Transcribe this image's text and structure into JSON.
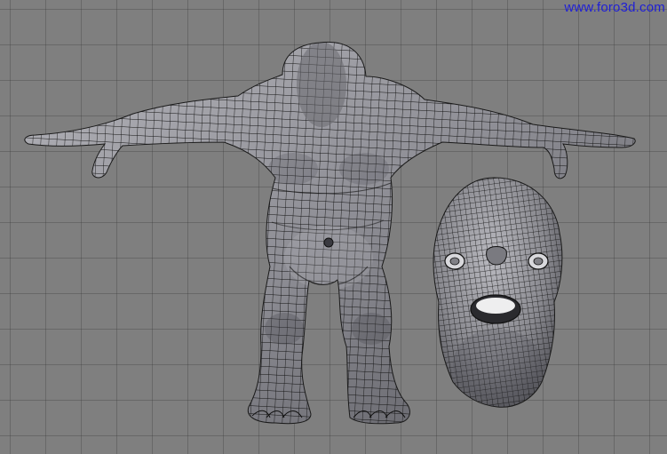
{
  "watermark": {
    "text": "www.foro3d.com",
    "color": "#1f1fd6"
  },
  "viewport": {
    "background_color": "#7f7f7f",
    "grid": true
  },
  "scene": {
    "objects": [
      {
        "name": "body-mesh",
        "display": "wireframe-over-solid"
      },
      {
        "name": "head-mesh",
        "display": "wireframe-over-solid"
      }
    ],
    "mesh_color": "#8e8e94",
    "wire_color": "#111111"
  }
}
